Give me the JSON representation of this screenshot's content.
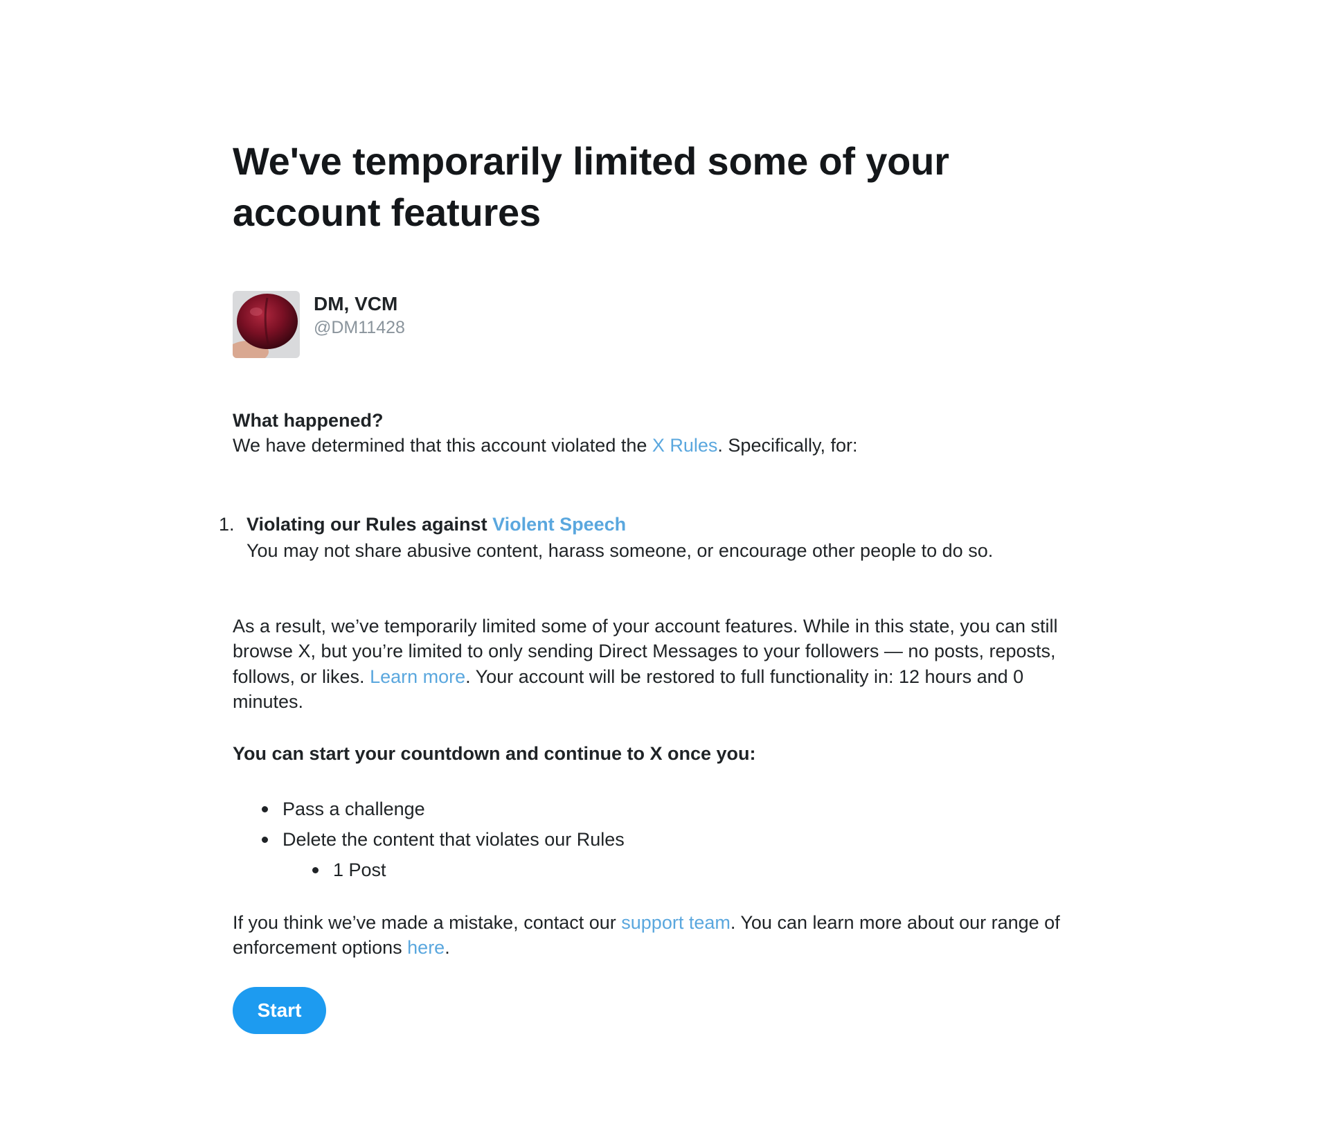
{
  "title": "We've temporarily limited some of your account features",
  "account": {
    "name": "DM, VCM",
    "handle": "@DM11428",
    "avatar_icon": "avatar-photo"
  },
  "what_happened": {
    "heading": "What happened?",
    "text_before": "We have determined that this account violated the ",
    "rules_link": "X Rules",
    "text_after": ". Specifically, for:"
  },
  "violations": [
    {
      "number": "1.",
      "title_prefix": "Violating our Rules against ",
      "title_link": "Violent Speech",
      "description": "You may not share abusive content, harass someone, or encourage other people to do so."
    }
  ],
  "result": {
    "text_before": "As a result, we’ve temporarily limited some of your account features. While in this state, you can still browse X, but you’re limited to only sending Direct Messages to your followers — no posts, reposts, follows, or likes. ",
    "learn_more_link": "Learn more",
    "text_after": ". Your account will be restored to full functionality in: 12 hours and 0 minutes."
  },
  "countdown": {
    "heading": "You can start your countdown and continue to X once you:",
    "items": [
      {
        "label": "Pass a challenge"
      },
      {
        "label": "Delete the content that violates our Rules"
      }
    ],
    "sub_items": [
      {
        "label": "1 Post"
      }
    ]
  },
  "mistake": {
    "text_before": "If you think we’ve made a mistake, contact our ",
    "support_link": "support team",
    "text_middle": ". You can learn more about our range of enforcement options ",
    "here_link": "here",
    "text_after": "."
  },
  "start_button": {
    "label": "Start"
  },
  "colors": {
    "link": "#5aa7de",
    "button": "#1d9bf0",
    "text": "#1f2326",
    "handle": "#8a949c"
  }
}
